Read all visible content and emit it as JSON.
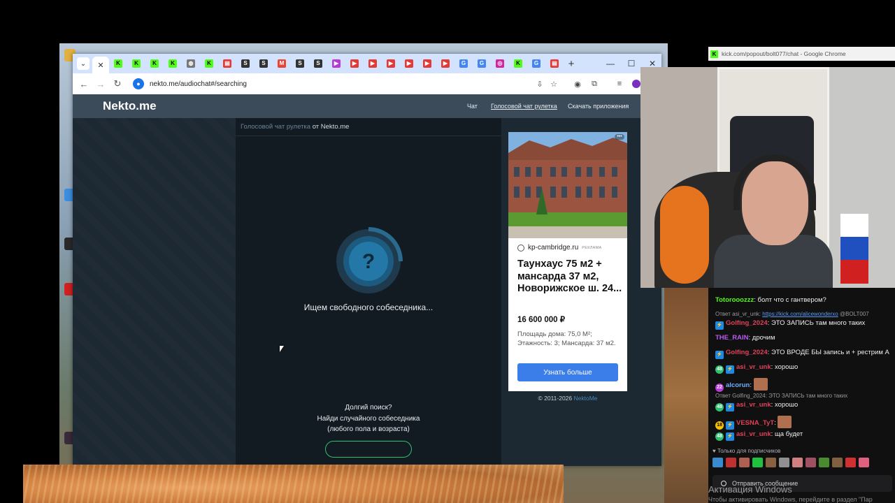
{
  "browser": {
    "url": "nekto.me/audiochat#/searching",
    "tab_close": "✕",
    "tabs_menu": "⌄",
    "new_tab": "+",
    "controls": {
      "minimize": "—",
      "maximize": "☐",
      "close": "✕"
    },
    "favicons": [
      {
        "label": "K",
        "color": "#53fc18"
      },
      {
        "label": "K",
        "color": "#53fc18"
      },
      {
        "label": "K",
        "color": "#53fc18"
      },
      {
        "label": "K",
        "color": "#53fc18"
      },
      {
        "label": "◍",
        "color": "#777777"
      },
      {
        "label": "K",
        "color": "#53fc18"
      },
      {
        "label": "▤",
        "color": "#e53935"
      },
      {
        "label": "S",
        "color": "#333333"
      },
      {
        "label": "S",
        "color": "#333333"
      },
      {
        "label": "M",
        "color": "#ea4335"
      },
      {
        "label": "S",
        "color": "#333333"
      },
      {
        "label": "S",
        "color": "#333333"
      },
      {
        "label": "▶",
        "color": "#b83ad6"
      },
      {
        "label": "▶",
        "color": "#e53935"
      },
      {
        "label": "▶",
        "color": "#e53935"
      },
      {
        "label": "▶",
        "color": "#e53935"
      },
      {
        "label": "▶",
        "color": "#e53935"
      },
      {
        "label": "▶",
        "color": "#e53935"
      },
      {
        "label": "▶",
        "color": "#e53935"
      },
      {
        "label": "G",
        "color": "#4285f4"
      },
      {
        "label": "G",
        "color": "#4285f4"
      },
      {
        "label": "◎",
        "color": "#d6249f"
      },
      {
        "label": "K",
        "color": "#53fc18"
      },
      {
        "label": "G",
        "color": "#4285f4"
      },
      {
        "label": "▤",
        "color": "#e53935"
      }
    ]
  },
  "site": {
    "logo": "Nekto.me",
    "nav": [
      "Чат",
      "Голосовой чат рулетка",
      "Скачать приложения"
    ],
    "breadcrumb_link": "Голосовой чат рулетка",
    "breadcrumb_rest": " от Nekto.me",
    "spinner_symbol": "?",
    "status": "Ищем свободного собеседника...",
    "long_search": [
      "Долгий поиск?",
      "Найди случайного собеседника",
      "(любого пола и возраста)"
    ],
    "copyright": "© 2011-2026 ",
    "copyright_link": "NektoMe"
  },
  "ad": {
    "dots": "•••",
    "domain": "kp-cambridge.ru",
    "badge": "РЕКЛАМА",
    "title": "Таунхаус 75 м2 + мансарда 37 м2, Новорижское ш. 24...",
    "price": "16 600 000 ₽",
    "description": "Площадь дома: 75,0 М²; Этажность: 3; Мансарда: 37 м2.",
    "button": "Узнать больше"
  },
  "kick_popout": {
    "title": "kick.com/popout/bolt077/chat - Google Chrome"
  },
  "chat": {
    "messages": [
      {
        "user": "Totorooozzz",
        "color": "#53fc18",
        "text": "болт что с гантвером?",
        "badges": []
      },
      {
        "reply": "Ответ asi_vr_unk: ",
        "reply_link": "https://kick.com/alicewonderxo",
        "reply_tail": " @BOLT007"
      },
      {
        "user": "Golfing_2024",
        "color": "#e0405a",
        "text": "ЭТО ЗАПИСЬ там много таких",
        "badges": [
          "s"
        ]
      },
      {
        "user": "THE_RAIN",
        "color": "#b85cf0",
        "text": "дрочим",
        "badges": []
      },
      {
        "user": "Golfing_2024",
        "color": "#e0405a",
        "text": "ЭТО ВРОДЕ БЫ запись и + рестрим А",
        "badges": [
          "s"
        ]
      },
      {
        "user": "asi_vr_unk",
        "color": "#e0405a",
        "text": "хорошо",
        "badges": [
          "g48",
          "s"
        ]
      },
      {
        "user": "alcorun",
        "color": "#6ab0ff",
        "text": "",
        "badges": [
          "p22"
        ],
        "emote": true
      },
      {
        "reply": "Ответ Golfing_2024: ЭТО ЗАПИСЬ там много таких",
        "reply_link": "",
        "reply_tail": ""
      },
      {
        "user": "asi_vr_unk",
        "color": "#e0405a",
        "text": "хорошо",
        "badges": [
          "g48",
          "s"
        ]
      },
      {
        "user": "VESNA_TyT",
        "color": "#e0405a",
        "text": "",
        "badges": [
          "y18",
          "s"
        ],
        "emote": true
      },
      {
        "user": "asi_vr_unk",
        "color": "#e0405a",
        "text": "ща будет",
        "badges": [
          "g48",
          "s"
        ]
      }
    ],
    "subs_only": "♥ Только для подписчиков",
    "input_placeholder": "Отправить сообщение"
  },
  "windows": {
    "activation_title": "Активация Windows",
    "activation_text": "Чтобы активировать Windows, перейдите в раздел \"Пар"
  },
  "colors": {
    "accent_green": "#2fbf71",
    "ad_button": "#3b7de9",
    "kick_green": "#53fc18"
  }
}
